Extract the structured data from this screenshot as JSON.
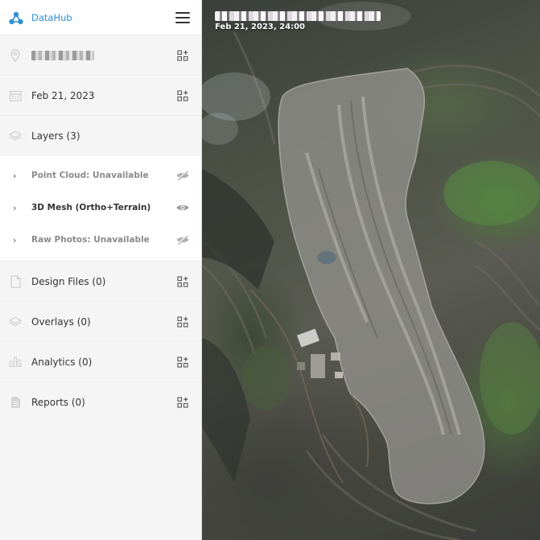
{
  "app": {
    "brand": "DataHub"
  },
  "site": {
    "location_redacted": ""
  },
  "date": {
    "label": "Feb 21, 2023"
  },
  "layers": {
    "title": "Layers (3)",
    "items": [
      {
        "label": "Point Cloud: Unavailable",
        "state": "unavailable",
        "icon": "eye-off-icon"
      },
      {
        "label": "3D Mesh (Ortho+Terrain)",
        "state": "visible",
        "icon": "eye-icon"
      },
      {
        "label": "Raw Photos: Unavailable",
        "state": "unavailable",
        "icon": "eye-off-icon"
      }
    ]
  },
  "sections": [
    {
      "label": "Design Files (0)",
      "icon": "file-icon"
    },
    {
      "label": "Overlays (0)",
      "icon": "layers-icon"
    },
    {
      "label": "Analytics (0)",
      "icon": "bar-chart-icon"
    },
    {
      "label": "Reports (0)",
      "icon": "document-icon"
    }
  ],
  "map": {
    "title_redacted": "",
    "timestamp": "Feb 21, 2023, 24:00"
  },
  "colors": {
    "brand": "#2d8fd5",
    "text": "#333333",
    "muted": "#8a8a8a",
    "sidebar_bg": "#f5f5f5"
  }
}
